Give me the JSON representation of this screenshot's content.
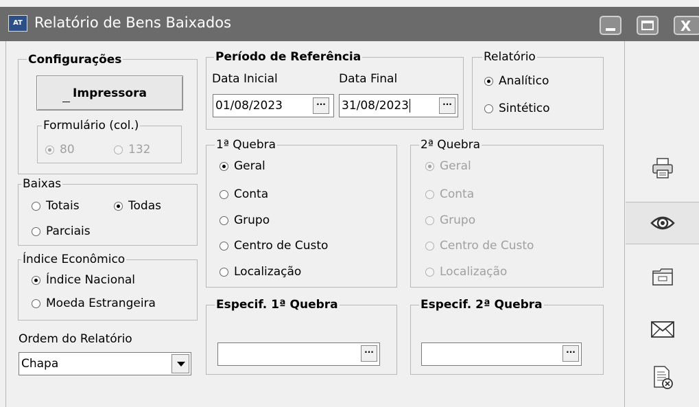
{
  "window": {
    "title": "Relatório de Bens Baixados",
    "app_icon": "AT"
  },
  "configuracoes": {
    "title": "Configurações",
    "printer_button": "Impressora",
    "formulario": {
      "title": "Formulário (col.)",
      "options": [
        "80",
        "132"
      ],
      "selected": "80"
    }
  },
  "baixas": {
    "title": "Baixas",
    "options": [
      "Totais",
      "Todas",
      "Parciais"
    ],
    "selected": "Todas"
  },
  "indice": {
    "title": "Índice Econômico",
    "options": [
      "Índice Nacional",
      "Moeda Estrangeira"
    ],
    "selected": "Índice Nacional"
  },
  "ordem": {
    "label": "Ordem do Relatório",
    "value": "Chapa"
  },
  "periodo": {
    "title": "Período de Referência",
    "data_inicial_label": "Data Inicial",
    "data_inicial": "01/08/2023",
    "data_final_label": "Data Final",
    "data_final": "31/08/2023"
  },
  "relatorio": {
    "title": "Relatório",
    "options": [
      "Analítico",
      "Sintético"
    ],
    "selected": "Analítico"
  },
  "quebra1": {
    "title": "1ª Quebra",
    "options": [
      "Geral",
      "Conta",
      "Grupo",
      "Centro de Custo",
      "Localização"
    ],
    "selected": "Geral"
  },
  "quebra2": {
    "title": "2ª Quebra",
    "options": [
      "Geral",
      "Conta",
      "Grupo",
      "Centro de Custo",
      "Localização"
    ],
    "selected": "Geral",
    "disabled": true
  },
  "especif1": {
    "title": "Especif. 1ª Quebra",
    "value": ""
  },
  "especif2": {
    "title": "Especif. 2ª Quebra",
    "value": ""
  },
  "sidebar": {
    "icons": [
      "printer-icon",
      "eye-icon",
      "folder-icon",
      "envelope-icon",
      "document-close-icon"
    ]
  }
}
